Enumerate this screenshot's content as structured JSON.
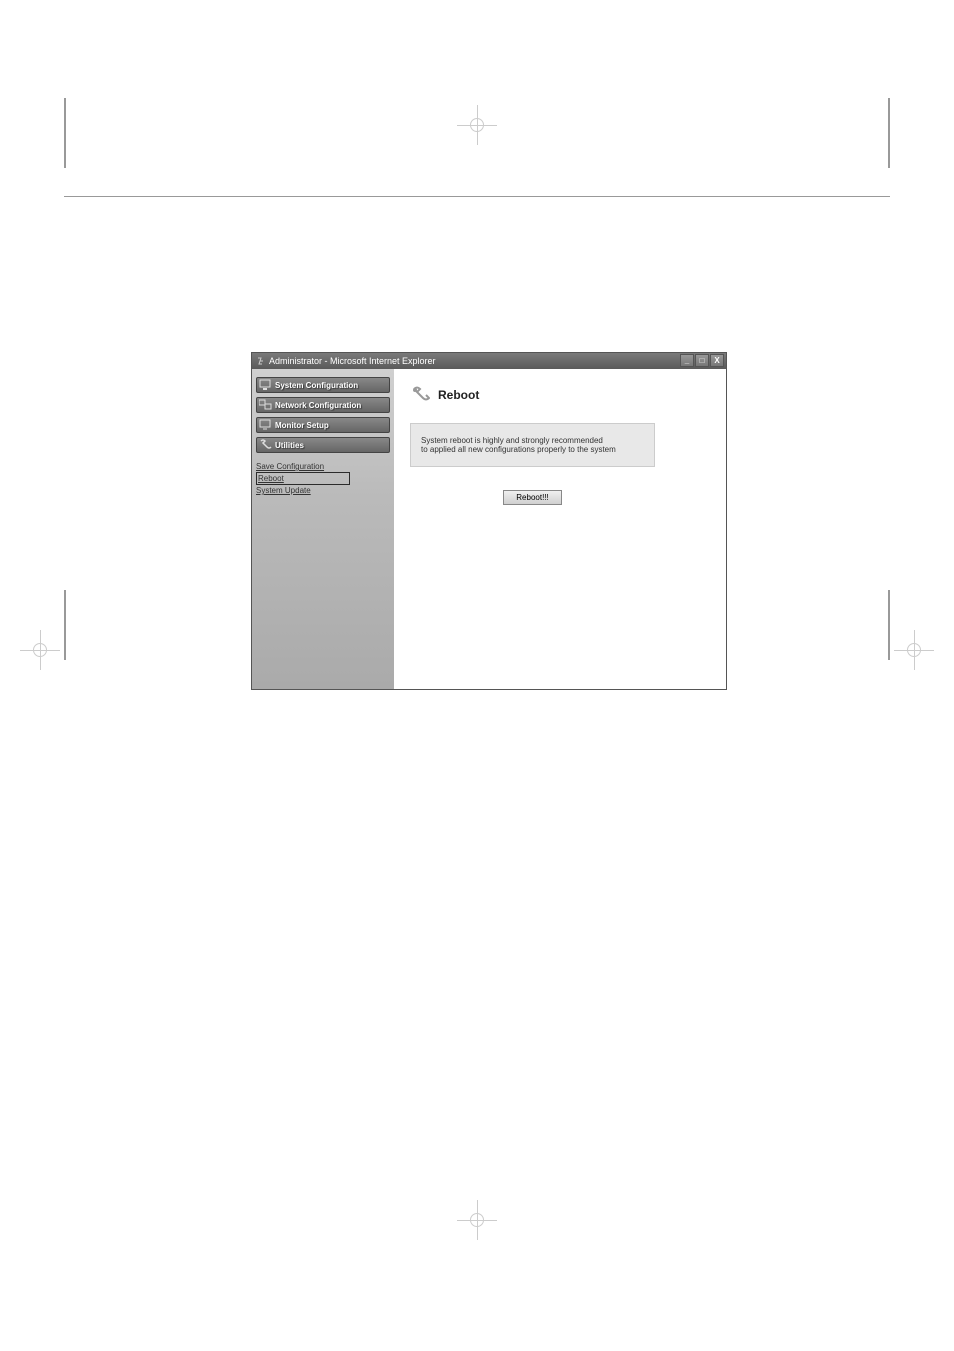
{
  "window": {
    "title": "Administrator - Microsoft Internet Explorer"
  },
  "sidebar": {
    "nav_buttons": [
      {
        "label": "System Configuration",
        "icon": "monitor"
      },
      {
        "label": "Network Configuration",
        "icon": "network"
      },
      {
        "label": "Monitor Setup",
        "icon": "display"
      },
      {
        "label": "Utilities",
        "icon": "wrench"
      }
    ],
    "links": [
      {
        "label": "Save Configuration",
        "highlighted": false
      },
      {
        "label": "Reboot",
        "highlighted": true
      },
      {
        "label": "System Update",
        "highlighted": false
      }
    ]
  },
  "content": {
    "title": "Reboot",
    "message_line1": "System reboot is highly and strongly recommended",
    "message_line2": "to applied all new configurations properly to the system",
    "button_label": "Reboot!!!"
  }
}
